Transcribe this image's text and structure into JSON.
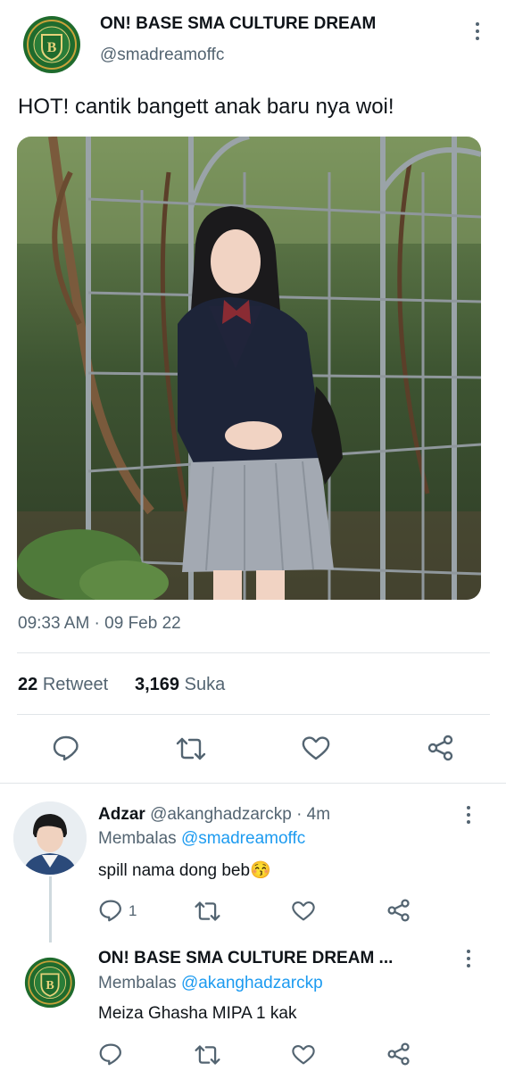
{
  "tweet": {
    "author_name": "ON! BASE SMA CULTURE DREAM",
    "author_handle": "@smadreamoffc",
    "text": "HOT! cantik bangett anak baru nya woi!",
    "timestamp": "09:33 AM · 09 Feb 22",
    "retweet_count": "22",
    "retweet_label": "Retweet",
    "like_count": "3,169",
    "like_label": "Suka"
  },
  "replies": [
    {
      "author_name": "Adzar",
      "author_handle": "@akanghadzarckp",
      "time": "· 4m",
      "replying_label": "Membalas",
      "replying_to": "@smadreamoffc",
      "text": "spill nama dong beb😚",
      "reply_count": "1"
    },
    {
      "author_name": "ON! BASE SMA CULTURE DREAM ...",
      "replying_label": "Membalas",
      "replying_to": "@akanghadzarckp",
      "text": "Meiza Ghasha MIPA 1 kak"
    }
  ],
  "colors": {
    "accent": "#1d9bf0",
    "muted": "#536471",
    "logo_green": "#1f6b2d",
    "logo_gold": "#c9a23a"
  }
}
